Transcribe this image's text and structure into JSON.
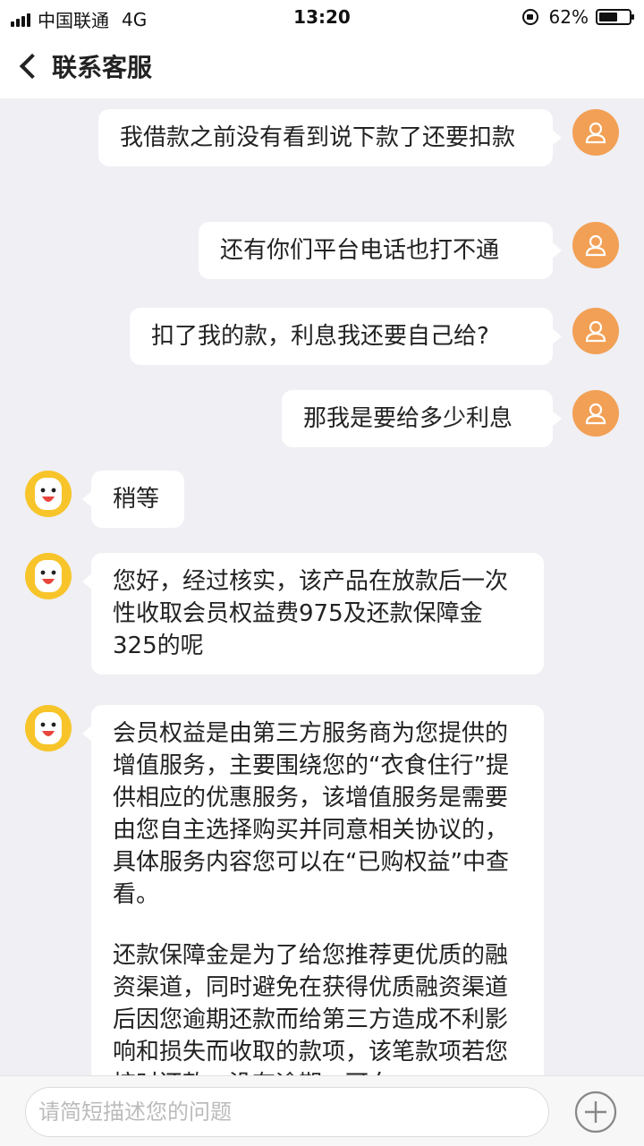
{
  "status_bar": {
    "carrier": "中国联通",
    "network": "4G",
    "time": "13:20",
    "battery": "62%",
    "battery_level": 0.62
  },
  "nav": {
    "title": "联系客服",
    "back_icon": "chevron-left-icon"
  },
  "colors": {
    "user_avatar": "#f2a055",
    "agent_avatar": "#f7c42a",
    "background": "#efeff4"
  },
  "messages": [
    {
      "from": "user",
      "text": "我借款之前没有看到说下款了还要扣款"
    },
    {
      "from": "user",
      "text": "还有你们平台电话也打不通"
    },
    {
      "from": "user",
      "text": "扣了我的款，利息我还要自己给?"
    },
    {
      "from": "user",
      "text": "那我是要给多少利息"
    },
    {
      "from": "agent",
      "text": "稍等"
    },
    {
      "from": "agent",
      "text": "您好，经过核实，该产品在放款后一次性收取会员权益费975及还款保障金325的呢"
    },
    {
      "from": "agent",
      "paragraphs": [
        "会员权益是由第三方服务商为您提供的增值服务，主要围绕您的“衣食住行”提供相应的优惠服务，该增值服务是需要由您自主选择购买并同意相关协议的，具体服务内容您可以在“已购权益”中查看。",
        "还款保障金是为了给您推荐更优质的融资渠道，同时避免在获得优质融资渠道后因您逾期还款而给第三方造成不利影响和损失而收取的款项，该笔款项若您按时还款，没有逾期，可向"
      ]
    }
  ],
  "input": {
    "placeholder": "请简短描述您的问题",
    "value": ""
  },
  "plus_icon": "plus-circle-icon"
}
